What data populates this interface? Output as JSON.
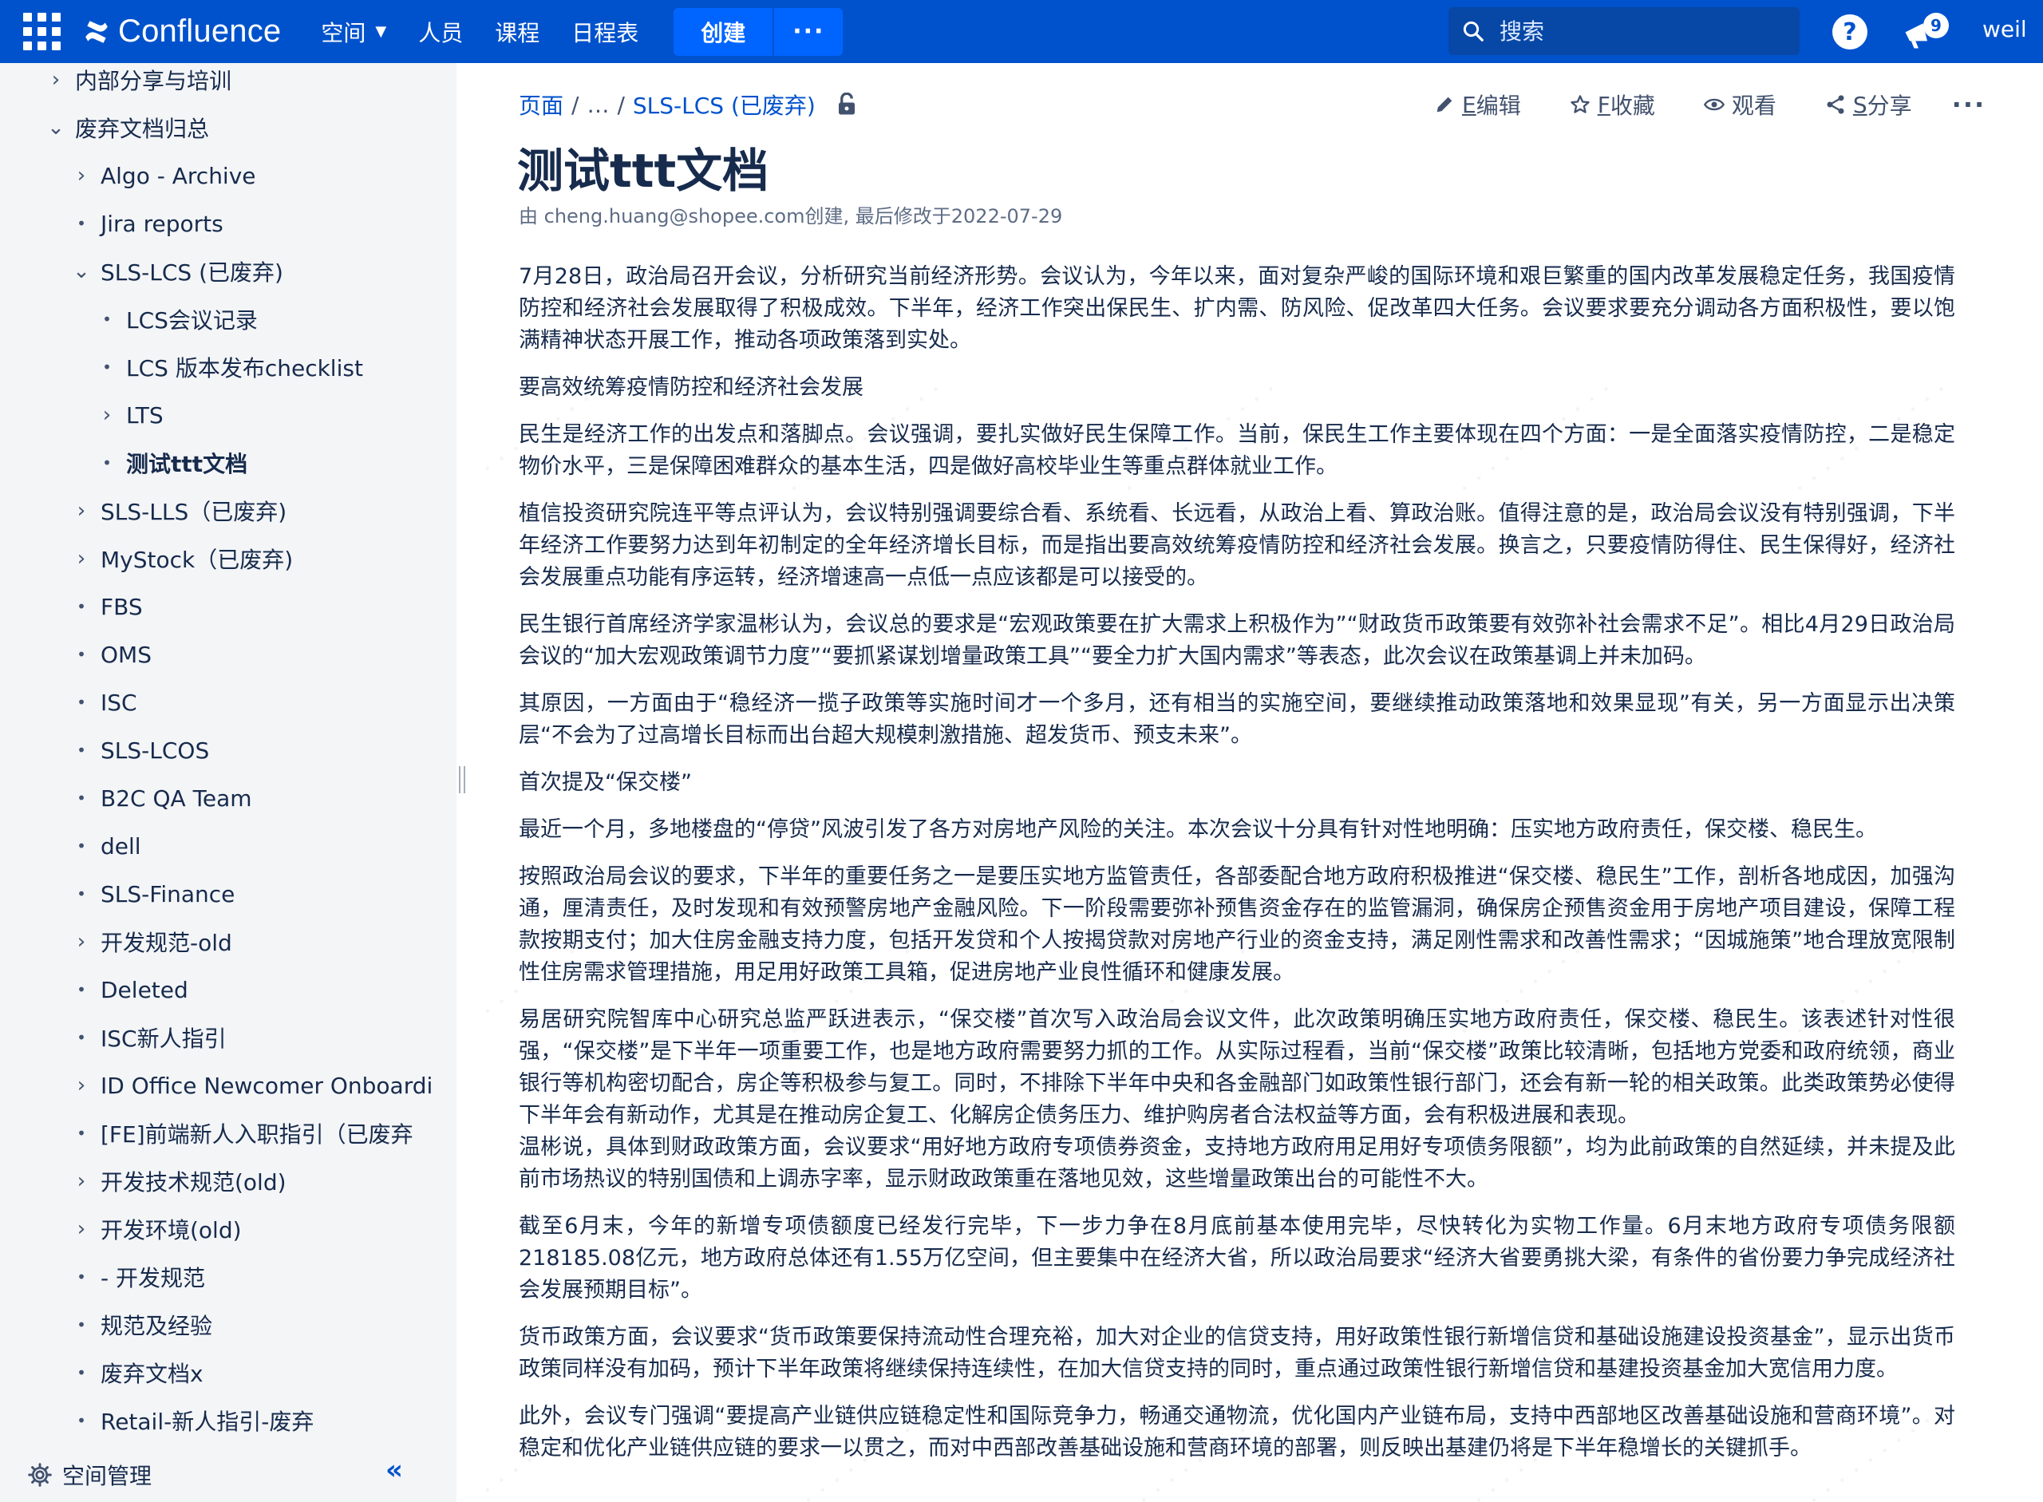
{
  "topbar": {
    "logo_text": "Confluence",
    "nav": [
      "空间",
      "人员",
      "课程",
      "日程表"
    ],
    "create_label": "创建",
    "create_more_label": "···",
    "search_placeholder": "搜索",
    "help_label": "?",
    "notification_count": "9",
    "user_label": "weil"
  },
  "sidebar": {
    "items": [
      {
        "label": "内部分享与培训",
        "marker": "›"
      },
      {
        "label": "废弃文档归总",
        "marker": "⌄"
      },
      {
        "label": "Algo - Archive",
        "marker": "›"
      },
      {
        "label": "Jira reports",
        "marker": "•"
      },
      {
        "label": "SLS-LCS (已废弃)",
        "marker": "⌄"
      },
      {
        "label": "LCS会议记录",
        "marker": "•"
      },
      {
        "label": "LCS 版本发布checklist",
        "marker": "•"
      },
      {
        "label": "LTS",
        "marker": "›"
      },
      {
        "label": "测试ttt文档",
        "marker": "•"
      },
      {
        "label": "SLS-LLS（已废弃)",
        "marker": "›"
      },
      {
        "label": "MyStock（已废弃)",
        "marker": "›"
      },
      {
        "label": "FBS",
        "marker": "•"
      },
      {
        "label": "OMS",
        "marker": "•"
      },
      {
        "label": "ISC",
        "marker": "•"
      },
      {
        "label": "SLS-LCOS",
        "marker": "•"
      },
      {
        "label": "B2C QA Team",
        "marker": "•"
      },
      {
        "label": "dell",
        "marker": "•"
      },
      {
        "label": "SLS-Finance",
        "marker": "•"
      },
      {
        "label": "开发规范-old",
        "marker": "›"
      },
      {
        "label": "Deleted",
        "marker": "•"
      },
      {
        "label": "ISC新人指引",
        "marker": "•"
      },
      {
        "label": "ID Office Newcomer Onboardi",
        "marker": "›"
      },
      {
        "label": "[FE]前端新人入职指引（已废弃",
        "marker": "•"
      },
      {
        "label": "开发技术规范(old)",
        "marker": "›"
      },
      {
        "label": "开发环境(old)",
        "marker": "›"
      },
      {
        "label": "- 开发规范",
        "marker": "•"
      },
      {
        "label": "规范及经验",
        "marker": "•"
      },
      {
        "label": "废弃文档x",
        "marker": "•"
      },
      {
        "label": "Retail-新人指引-废弃",
        "marker": "•"
      }
    ],
    "space_admin_label": "空间管理",
    "collapse_label": "«"
  },
  "breadcrumb": {
    "root": "页面",
    "ellipsis": "…",
    "parent": "SLS-LCS (已废弃)"
  },
  "actions": {
    "edit": {
      "key": "E",
      "label": "编辑"
    },
    "star": {
      "key": "F",
      "label": "收藏"
    },
    "watch": {
      "label": "观看"
    },
    "share": {
      "key": "S",
      "label": "分享"
    },
    "more": "···"
  },
  "page": {
    "title": "测试ttt文档",
    "byline": "由 cheng.huang@shopee.com创建, 最后修改于2022-07-29",
    "paragraphs": [
      "7月28日，政治局召开会议，分析研究当前经济形势。会议认为，今年以来，面对复杂严峻的国际环境和艰巨繁重的国内改革发展稳定任务，我国疫情防控和经济社会发展取得了积极成效。下半年，经济工作突出保民生、扩内需、防风险、促改革四大任务。会议要求要充分调动各方面积极性，要以饱满精神状态开展工作，推动各项政策落到实处。",
      "要高效统筹疫情防控和经济社会发展",
      "民生是经济工作的出发点和落脚点。会议强调，要扎实做好民生保障工作。当前，保民生工作主要体现在四个方面：一是全面落实疫情防控，二是稳定物价水平，三是保障困难群众的基本生活，四是做好高校毕业生等重点群体就业工作。",
      "植信投资研究院连平等点评认为，会议特别强调要综合看、系统看、长远看，从政治上看、算政治账。值得注意的是，政治局会议没有特别强调，下半年经济工作要努力达到年初制定的全年经济增长目标，而是指出要高效统筹疫情防控和经济社会发展。换言之，只要疫情防得住、民生保得好，经济社会发展重点功能有序运转，经济增速高一点低一点应该都是可以接受的。",
      "民生银行首席经济学家温彬认为，会议总的要求是“宏观政策要在扩大需求上积极作为”“财政货币政策要有效弥补社会需求不足”。相比4月29日政治局会议的“加大宏观政策调节力度”“要抓紧谋划增量政策工具”“要全力扩大国内需求”等表态，此次会议在政策基调上并未加码。",
      "其原因，一方面由于“稳经济一揽子政策等实施时间才一个多月，还有相当的实施空间，要继续推动政策落地和效果显现”有关，另一方面显示出决策层“不会为了过高增长目标而出台超大规模刺激措施、超发货币、预支未来”。",
      "首次提及“保交楼”",
      "最近一个月，多地楼盘的“停贷”风波引发了各方对房地产风险的关注。本次会议十分具有针对性地明确：压实地方政府责任，保交楼、稳民生。",
      "按照政治局会议的要求，下半年的重要任务之一是要压实地方监管责任，各部委配合地方政府积极推进“保交楼、稳民生”工作，剖析各地成因，加强沟通，厘清责任，及时发现和有效预警房地产金融风险。下一阶段需要弥补预售资金存在的监管漏洞，确保房企预售资金用于房地产项目建设，保障工程款按期支付；加大住房金融支持力度，包括开发贷和个人按揭贷款对房地产行业的资金支持，满足刚性需求和改善性需求；“因城施策”地合理放宽限制性住房需求管理措施，用足用好政策工具箱，促进房地产业良性循环和健康发展。",
      "易居研究院智库中心研究总监严跃进表示，“保交楼”首次写入政治局会议文件，此次政策明确压实地方政府责任，保交楼、稳民生。该表述针对性很强，“保交楼”是下半年一项重要工作，也是地方政府需要努力抓的工作。从实际过程看，当前“保交楼”政策比较清晰，包括地方党委和政府统领，商业银行等机构密切配合，房企等积极参与复工。同时，不排除下半年中央和各金融部门如政策性银行部门，还会有新一轮的相关政策。此类政策势必使得下半年会有新动作，尤其是在推动房企复工、化解房企债务压力、维护购房者合法权益等方面，会有积极进展和表现。",
      "温彬说，具体到财政政策方面，会议要求“用好地方政府专项债券资金，支持地方政府用足用好专项债务限额”，均为此前政策的自然延续，并未提及此前市场热议的特别国债和上调赤字率，显示财政政策重在落地见效，这些增量政策出台的可能性不大。",
      "截至6月末，今年的新增专项债额度已经发行完毕，下一步力争在8月底前基本使用完毕，尽快转化为实物工作量。6月末地方政府专项债务限额218185.08亿元，地方政府总体还有1.55万亿空间，但主要集中在经济大省，所以政治局要求“经济大省要勇挑大梁，有条件的省份要力争完成经济社会发展预期目标”。",
      "货币政策方面，会议要求“货币政策要保持流动性合理充裕，加大对企业的信贷支持，用好政策性银行新增信贷和基础设施建设投资基金”，显示出货币政策同样没有加码，预计下半年政策将继续保持连续性，在加大信贷支持的同时，重点通过政策性银行新增信贷和基建投资基金加大宽信用力度。",
      "此外，会议专门强调“要提高产业链供应链稳定性和国际竞争力，畅通交通物流，优化国内产业链布局，支持中西部地区改善基础设施和营商环境”。对稳定和优化产业链供应链的要求一以贯之，而对中西部改善基础设施和营商环境的部署，则反映出基建仍将是下半年稳增长的关键抓手。"
    ]
  },
  "colors": {
    "brand": "#0052cc",
    "sidebar_bg": "#f4f5f7",
    "link": "#0052cc",
    "text": "#172b4d"
  }
}
